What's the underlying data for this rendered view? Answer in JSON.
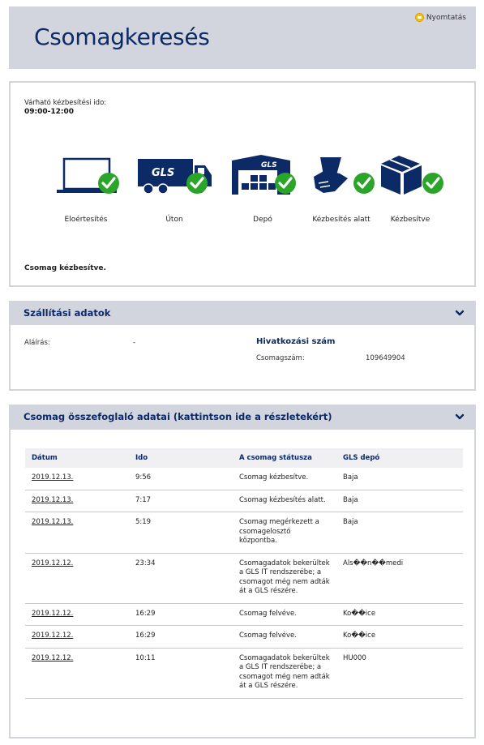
{
  "header": {
    "title": "Csomagkeresés",
    "print_label": "Nyomtatás"
  },
  "status": {
    "eta_label": "Várható kézbesítési ido:",
    "eta_value": "09:00-12:00",
    "steps": [
      {
        "label": "Eloértesítés",
        "icon": "laptop-icon",
        "done": true
      },
      {
        "label": "Úton",
        "icon": "gls-truck-icon",
        "done": true
      },
      {
        "label": "Depó",
        "icon": "gls-depot-icon",
        "done": true
      },
      {
        "label": "Kézbesítés alatt",
        "icon": "parcel-hand-icon",
        "done": true
      },
      {
        "label": "Kézbesítve",
        "icon": "box-icon",
        "done": true
      }
    ],
    "delivered_text": "Csomag kézbesítve.",
    "check_color": "#2aa52a",
    "icon_color": "#0c2a66"
  },
  "shipping": {
    "title": "Szállítási adatok",
    "signature_label": "Aláírás:",
    "signature_value": "-",
    "reference_title": "Hivatkozási szám",
    "parcel_number_label": "Csomagszám:",
    "parcel_number_value": "109649904"
  },
  "summary": {
    "title": "Csomag összefoglaló adatai (kattintson ide a részletekért)",
    "columns": [
      "Dátum",
      "Ido",
      "A csomag státusza",
      "GLS depó"
    ],
    "rows": [
      {
        "date": "2019.12.13.",
        "time": "9:56",
        "status": "Csomag kézbesítve.",
        "depot": "Baja"
      },
      {
        "date": "2019.12.13.",
        "time": "7:17",
        "status": "Csomag kézbesítés alatt.",
        "depot": "Baja"
      },
      {
        "date": "2019.12.13.",
        "time": "5:19",
        "status": "Csomag megérkezett a csomagelosztó központba.",
        "depot": "Baja"
      },
      {
        "date": "2019.12.12.",
        "time": "23:34",
        "status": "Csomagadatok bekerültek a GLS IT rendszerébe; a csomagot még nem adták át a GLS részére.",
        "depot": "Als��n��medi"
      },
      {
        "date": "2019.12.12.",
        "time": "16:29",
        "status": "Csomag felvéve.",
        "depot": "Ko��ice"
      },
      {
        "date": "2019.12.12.",
        "time": "16:29",
        "status": "Csomag felvéve.",
        "depot": "Ko��ice"
      },
      {
        "date": "2019.12.12.",
        "time": "10:11",
        "status": "Csomagadatok bekerültek a GLS IT rendszerébe; a csomagot még nem adták át a GLS részére.",
        "depot": "HU000"
      }
    ]
  }
}
